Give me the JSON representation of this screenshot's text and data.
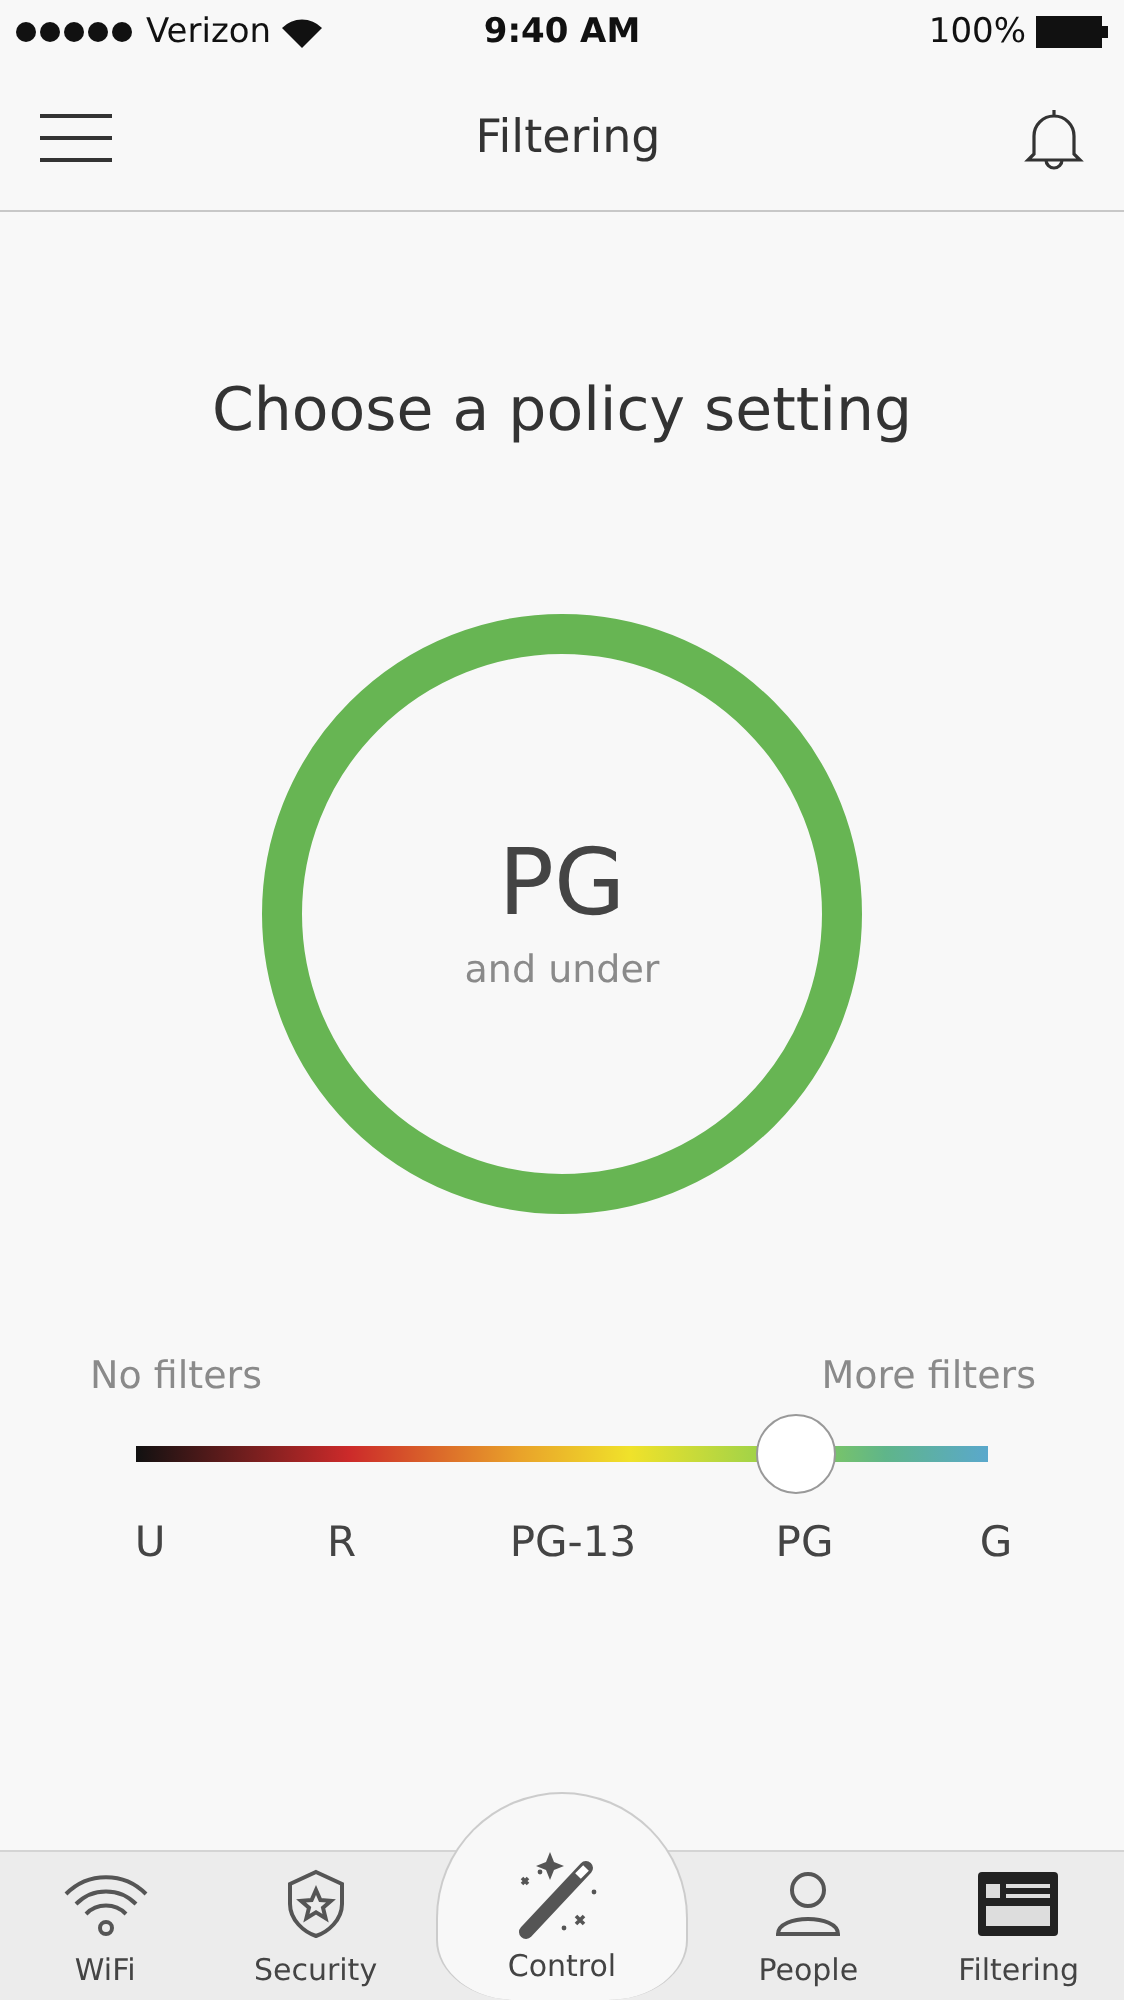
{
  "status_bar": {
    "carrier": "Verizon",
    "time": "9:40 AM",
    "battery": "100%"
  },
  "header": {
    "title": "Filtering"
  },
  "heading": "Choose a policy setting",
  "policy": {
    "rating": "PG",
    "caption": "and under"
  },
  "slider": {
    "left_label": "No filters",
    "right_label": "More filters",
    "level": 0.774,
    "ratings": [
      "U",
      "R",
      "PG-13",
      "PG",
      "G"
    ]
  },
  "tab_bar": [
    {
      "label": "WiFi",
      "kind": "wifi",
      "selected": false
    },
    {
      "label": "Security",
      "kind": "shield",
      "selected": false
    },
    {
      "label": "Control",
      "kind": "wand",
      "selected": false
    },
    {
      "label": "People",
      "kind": "person",
      "selected": false
    },
    {
      "label": "Filtering",
      "kind": "filter",
      "selected": true
    }
  ]
}
